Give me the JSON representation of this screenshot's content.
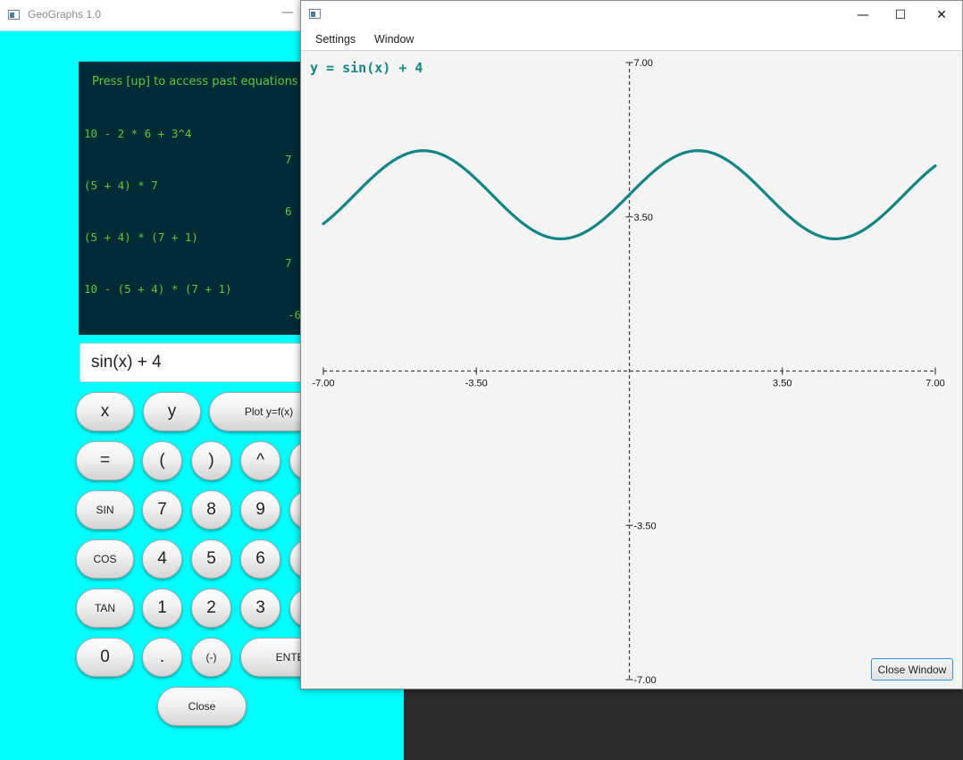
{
  "calculator": {
    "window_title": "GeoGraphs 1.0",
    "minimize_glyph": "—",
    "history_hint": "Press [up] to access past equations",
    "history": [
      {
        "expression": "10 - 2 * 6 + 3^4",
        "result": "7"
      },
      {
        "expression": "(5 + 4) * 7",
        "result": "6"
      },
      {
        "expression": "(5 + 4) * (7 + 1)",
        "result": "7"
      },
      {
        "expression": "10 - (5 + 4) * (7 + 1)",
        "result": "-6"
      }
    ],
    "input_value": "sin(x) + 4",
    "keys": {
      "x": "x",
      "y": "y",
      "plot": "Plot y=f(x)",
      "equals": "=",
      "lparen": "(",
      "rparen": ")",
      "caret": "^",
      "sin": "SIN",
      "cos": "COS",
      "tan": "TAN",
      "d7": "7",
      "d8": "8",
      "d9": "9",
      "d4": "4",
      "d5": "5",
      "d6": "6",
      "d1": "1",
      "d2": "2",
      "d3": "3",
      "d0": "0",
      "dot": ".",
      "neg": "(-)",
      "enter": "ENTER",
      "close": "Close"
    },
    "colors": {
      "background": "#00ffff",
      "history_bg": "#002b36",
      "history_text": "#5fc83a"
    }
  },
  "graph_window": {
    "caption_buttons": {
      "minimize": "—",
      "maximize": "☐",
      "close": "✕"
    },
    "menu": {
      "settings": "Settings",
      "window": "Window"
    },
    "equation_label": "y = sin(x) + 4",
    "close_window_label": "Close Window",
    "colors": {
      "curve": "#138585",
      "axis": "#444444",
      "background": "#f4f4f4"
    }
  },
  "chart_data": {
    "type": "line",
    "function": "sin(x) + 4",
    "xlim": [
      -7,
      7
    ],
    "ylim": [
      -7,
      7
    ],
    "x_ticks": [
      "-7.00",
      "-3.50",
      "3.50",
      "7.00"
    ],
    "y_ticks": [
      "7.00",
      "3.50",
      "-3.50",
      "-7.00"
    ],
    "x_tick_values": [
      -7,
      -3.5,
      3.5,
      7
    ],
    "y_tick_values": [
      7,
      3.5,
      -3.5,
      -7
    ],
    "plotted_range": [
      -7,
      7
    ],
    "grid": false,
    "axis_style": "dashed"
  }
}
